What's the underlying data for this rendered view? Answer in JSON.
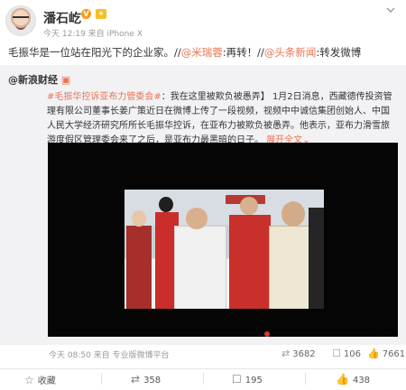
{
  "post": {
    "author": "潘石屹",
    "vbadge": "V",
    "meta": "今天 12:19 来自 iPhone X",
    "text_main": "毛振华是一位站在阳光下的企业家。//",
    "mention1": "@米瑞蓉",
    "text_mid": ":再转！//",
    "mention2": "@头条新闻",
    "text_end": ":转发微博"
  },
  "repost": {
    "source": "@新浪财经",
    "topic": "#毛振华控诉亚布力管委会#",
    "body": "：我在这里被欺负被愚弄】 1月2日消息，西藏德传投资管理有限公司董事长姜广策近日在微博上传了一段视频，视频中中诚信集团创始人、中国人民大学经济研究所所长毛振华控诉，在亚布力被欺负被愚弄。他表示，亚布力滑雪旅游度假区管理委会来了之后，是亚布力最黑暗的日子。",
    "more": "展开全文",
    "time": "今天 08:50 来自 专业版微博平台",
    "reposts": "3682",
    "comments": "106",
    "likes": "7661"
  },
  "actions": {
    "favorite": "收藏",
    "repost": "358",
    "comment": "195",
    "like": "438"
  },
  "icons": {
    "chevron": "chevron-down-icon",
    "favorite": "star-icon",
    "repost": "repost-icon",
    "comment": "comment-icon",
    "like": "thumbs-up-icon"
  },
  "colors": {
    "link": "#eb7350",
    "badge": "#f59c19",
    "repost_bg": "#f2f2f5"
  }
}
